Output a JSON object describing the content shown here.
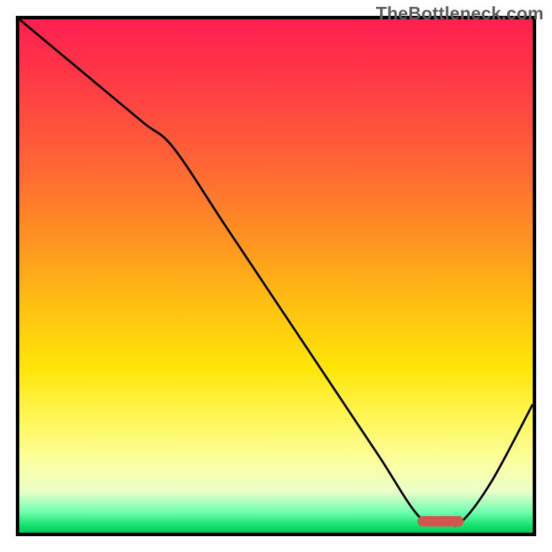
{
  "watermark": "TheBottleneck.com",
  "chart_data": {
    "type": "line",
    "title": "",
    "xlabel": "",
    "ylabel": "",
    "xlim": [
      0,
      100
    ],
    "ylim": [
      0,
      100
    ],
    "grid": false,
    "legend": false,
    "series": [
      {
        "name": "bottleneck-curve",
        "x": [
          0,
          12,
          24,
          30,
          40,
          50,
          60,
          70,
          78,
          83,
          86,
          92,
          100
        ],
        "y": [
          100,
          90,
          80,
          75,
          60,
          45,
          30,
          15,
          3,
          2,
          2,
          10,
          25
        ],
        "note": "y is proportion of plot height from bottom; curve descends from top-left, flattens near x≈80–86 at bottom, then rises to the right edge"
      }
    ],
    "marker": {
      "x_center_pct": 82,
      "y_from_bottom_pct": 2.2,
      "width_pct": 9,
      "height_pct": 2,
      "color": "#d1574e",
      "shape": "rounded-bar"
    },
    "background_gradient": {
      "orientation": "vertical",
      "stops": [
        {
          "pos": 0.0,
          "color": "#ff1f4f"
        },
        {
          "pos": 0.3,
          "color": "#ff6a33"
        },
        {
          "pos": 0.6,
          "color": "#ffd000"
        },
        {
          "pos": 0.85,
          "color": "#fdffb0"
        },
        {
          "pos": 0.97,
          "color": "#5fffa0"
        },
        {
          "pos": 1.0,
          "color": "#07c65e"
        }
      ]
    }
  }
}
